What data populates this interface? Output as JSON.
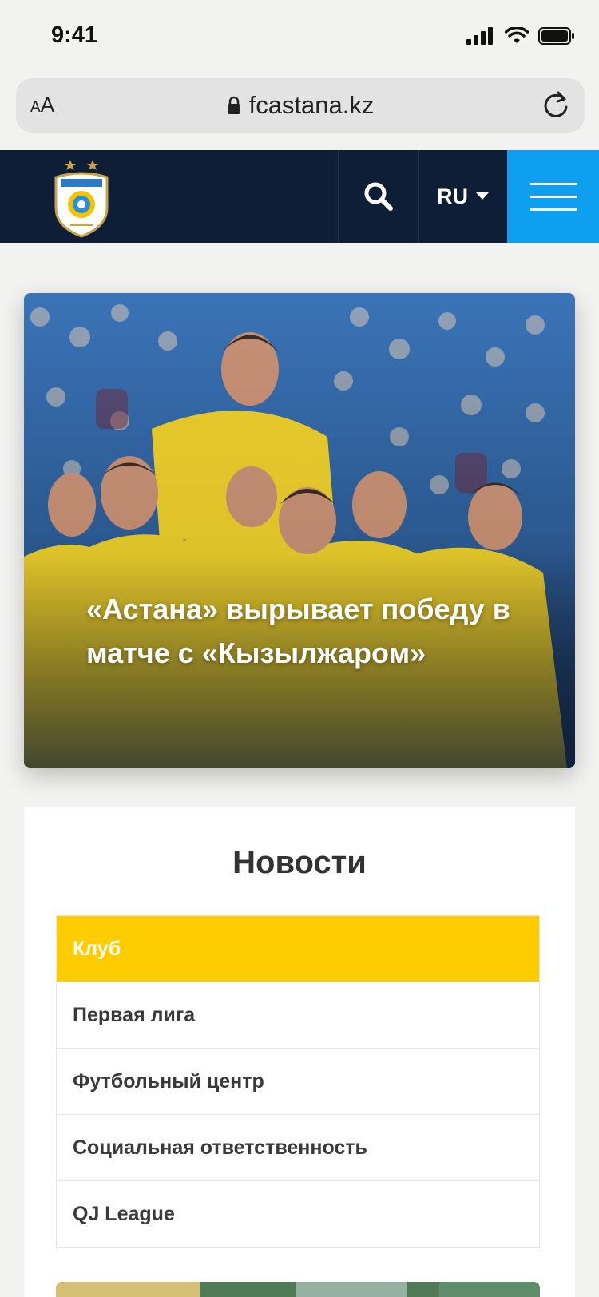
{
  "status_bar": {
    "time": "9:41"
  },
  "browser": {
    "text_size_small": "A",
    "text_size_large": "A",
    "url": "fcastana.kz"
  },
  "header": {
    "lang": "RU"
  },
  "hero": {
    "title": "«Астана» вырывает победу в матче с «Кызылжаром»"
  },
  "news": {
    "title": "Новости",
    "categories": [
      {
        "label": "Клуб",
        "active": true
      },
      {
        "label": "Первая лига",
        "active": false
      },
      {
        "label": "Футбольный центр",
        "active": false
      },
      {
        "label": "Социальная ответственность",
        "active": false
      },
      {
        "label": "QJ League",
        "active": false
      }
    ]
  },
  "colors": {
    "header_bg": "#0e1e36",
    "menu_accent": "#0f9ff0",
    "active_category": "#fdcd00"
  },
  "icons": [
    "signal-icon",
    "wifi-icon",
    "battery-icon",
    "lock-icon",
    "reload-icon",
    "search-icon",
    "chevron-down-icon",
    "hamburger-icon"
  ]
}
